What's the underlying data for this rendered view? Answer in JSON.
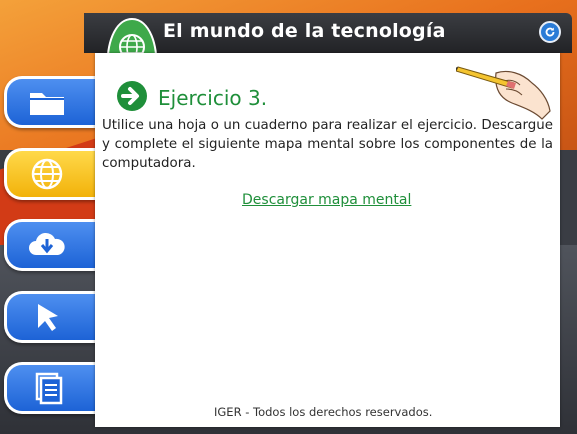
{
  "app": {
    "title": "El mundo de la tecnología"
  },
  "sidebar": {
    "items": [
      {
        "icon": "folder-icon",
        "active": false
      },
      {
        "icon": "globe-icon",
        "active": true
      },
      {
        "icon": "cloud-download-icon",
        "active": false
      },
      {
        "icon": "cursor-arrow-icon",
        "active": false
      },
      {
        "icon": "documents-icon",
        "active": false
      }
    ]
  },
  "content": {
    "exercise_title": "Ejercicio 3.",
    "instructions": "Utilice una hoja o un cuaderno para realizar el ejercicio. Descargue y complete el siguiente mapa mental sobre los componentes de la computadora.",
    "download_link": "Descargar mapa mental"
  },
  "footer": {
    "text": "IGER - Todos los derechos reservados."
  },
  "colors": {
    "accent_green": "#1f8f3a",
    "sidebar_blue": "#1d63d6",
    "sidebar_active": "#f2b20a",
    "header_dark": "#222326",
    "background_orange": "#e8701d"
  }
}
